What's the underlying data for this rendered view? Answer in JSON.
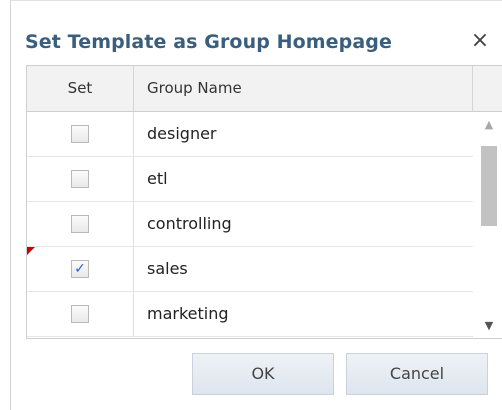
{
  "dialog": {
    "title": "Set Template as Group Homepage",
    "close_glyph": "×"
  },
  "grid": {
    "columns": {
      "set": "Set",
      "name": "Group Name"
    },
    "rows": [
      {
        "name": "designer",
        "checked": false,
        "dirty": false
      },
      {
        "name": "etl",
        "checked": false,
        "dirty": false
      },
      {
        "name": "controlling",
        "checked": false,
        "dirty": false
      },
      {
        "name": "sales",
        "checked": true,
        "dirty": true
      },
      {
        "name": "marketing",
        "checked": false,
        "dirty": false
      }
    ],
    "scrollbar": {
      "up_glyph": "▲",
      "down_glyph": "▼"
    }
  },
  "buttons": {
    "ok": "OK",
    "cancel": "Cancel"
  },
  "colors": {
    "title": "#3a5f7e",
    "checkmark": "#2760c8",
    "dirty_marker": "#cc0000",
    "header_bg": "#f2f2f2",
    "button_bg": "#e4eaf1"
  },
  "icons": {
    "close": "close-icon",
    "checkmark": "checkmark-icon",
    "scroll_up": "arrow-up-icon",
    "scroll_down": "arrow-down-icon"
  }
}
